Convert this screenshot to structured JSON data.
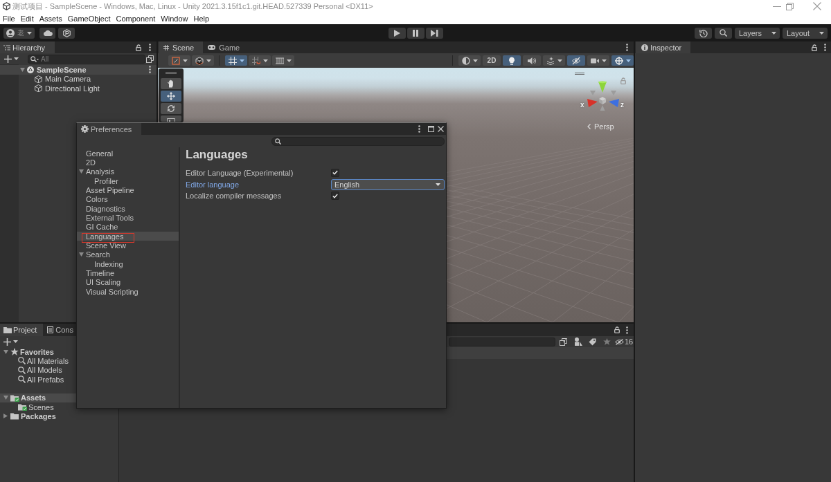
{
  "window": {
    "title": "测试项目 - SampleScene - Windows, Mac, Linux - Unity 2021.3.15f1c1.git.HEAD.527339 Personal <DX11>"
  },
  "menu": [
    "File",
    "Edit",
    "Assets",
    "GameObject",
    "Component",
    "Window",
    "Help"
  ],
  "toolbar": {
    "account": {
      "initial": "老"
    },
    "play_controls": [
      {
        "kind": "play"
      },
      {
        "kind": "pause"
      },
      {
        "kind": "step"
      }
    ],
    "dropdowns": [
      "Layers",
      "Layout"
    ]
  },
  "hierarchy": {
    "tabs": [
      {
        "label": "Hierarchy",
        "selected": true
      }
    ],
    "search": {
      "placeholder": "All"
    },
    "items": [
      {
        "label": "SampleScene",
        "kind": "scene",
        "expanded": true,
        "selected": false,
        "children": [
          {
            "label": "Main Camera",
            "kind": "object",
            "selected": false
          },
          {
            "label": "Directional Light",
            "kind": "object",
            "selected": false
          }
        ]
      }
    ]
  },
  "scene_view": {
    "tabs": [
      {
        "label": "Scene",
        "kind": "scene",
        "selected": true
      },
      {
        "label": "Game",
        "kind": "game",
        "selected": false
      }
    ],
    "toolbar_groups": [
      {
        "buttons": [
          {
            "kind": "draw-mode",
            "on": false,
            "dropdown": true
          },
          {
            "kind": "cube",
            "on": false,
            "dropdown": true
          }
        ]
      },
      {
        "buttons": [
          {
            "kind": "grid-snap",
            "on": true,
            "dropdown": true
          },
          {
            "kind": "increment-snap",
            "on": false,
            "dropdown": true
          },
          {
            "kind": "ruler",
            "on": false,
            "dropdown": true
          }
        ]
      },
      {
        "buttons": [
          {
            "kind": "shading",
            "on": false,
            "dropdown": true
          },
          {
            "kind": "label",
            "label": "2D",
            "on": false,
            "dropdown": false
          },
          {
            "kind": "light",
            "on": true,
            "dropdown": false
          },
          {
            "kind": "audio",
            "on": false,
            "dropdown": false
          },
          {
            "kind": "effects",
            "on": false,
            "dropdown": true
          },
          {
            "kind": "visibility",
            "on": true,
            "dropdown": false
          },
          {
            "kind": "camera",
            "on": false,
            "dropdown": true
          },
          {
            "kind": "gizmos",
            "on": true,
            "dropdown": true
          }
        ]
      }
    ],
    "tools": [
      {
        "kind": "hand",
        "selected": false
      },
      {
        "kind": "move",
        "selected": true
      },
      {
        "kind": "rotate",
        "selected": false
      },
      {
        "kind": "rect",
        "selected": false
      }
    ],
    "gizmo": {
      "axis_labels": [
        "x",
        "z"
      ],
      "projection": "Persp"
    }
  },
  "inspector": {
    "tabs": [
      {
        "label": "Inspector",
        "selected": true
      }
    ]
  },
  "project": {
    "tabs": [
      {
        "label": "Project",
        "kind": "project",
        "selected": true
      },
      {
        "label": "Cons",
        "kind": "console",
        "selected": false
      }
    ],
    "hidden_count": "16",
    "tree": [
      {
        "label": "Favorites",
        "kind": "favorites",
        "expanded": true,
        "selected": false,
        "children": [
          {
            "label": "All Materials",
            "kind": "search",
            "selected": false
          },
          {
            "label": "All Models",
            "kind": "search",
            "selected": false
          },
          {
            "label": "All Prefabs",
            "kind": "search",
            "selected": false
          }
        ]
      },
      {
        "label": "Assets",
        "kind": "folder",
        "expanded": true,
        "selected": true,
        "synced": true,
        "children": [
          {
            "label": "Scenes",
            "kind": "folder",
            "selected": false,
            "synced": true
          }
        ]
      },
      {
        "label": "Packages",
        "kind": "folder",
        "expanded": false,
        "selected": false,
        "synced": false
      }
    ]
  },
  "preferences": {
    "title": "Preferences",
    "sections": [
      {
        "label": "General",
        "selected": false,
        "annotated": false
      },
      {
        "label": "2D",
        "selected": false,
        "annotated": false
      },
      {
        "label": "Analysis",
        "expanded": true,
        "selected": false,
        "annotated": false,
        "children": [
          {
            "label": "Profiler",
            "selected": false,
            "annotated": false
          }
        ]
      },
      {
        "label": "Asset Pipeline",
        "selected": false,
        "annotated": false
      },
      {
        "label": "Colors",
        "selected": false,
        "annotated": false
      },
      {
        "label": "Diagnostics",
        "selected": false,
        "annotated": false
      },
      {
        "label": "External Tools",
        "selected": false,
        "annotated": false
      },
      {
        "label": "GI Cache",
        "selected": false,
        "annotated": false
      },
      {
        "label": "Languages",
        "selected": true,
        "annotated": true
      },
      {
        "label": "Scene View",
        "selected": false,
        "annotated": false
      },
      {
        "label": "Search",
        "expanded": true,
        "selected": false,
        "annotated": false,
        "children": [
          {
            "label": "Indexing",
            "selected": false,
            "annotated": false
          }
        ]
      },
      {
        "label": "Timeline",
        "selected": false,
        "annotated": false
      },
      {
        "label": "UI Scaling",
        "selected": false,
        "annotated": false
      },
      {
        "label": "Visual Scripting",
        "selected": false,
        "annotated": false
      }
    ],
    "page": {
      "title": "Languages",
      "settings": [
        {
          "label": "Editor Language (Experimental)",
          "kind": "checkbox",
          "checked": true,
          "focused": false
        },
        {
          "label": "Editor language",
          "kind": "dropdown",
          "value": "English",
          "focused": true
        },
        {
          "label": "Localize compiler messages",
          "kind": "checkbox",
          "checked": true,
          "focused": false
        }
      ]
    }
  }
}
